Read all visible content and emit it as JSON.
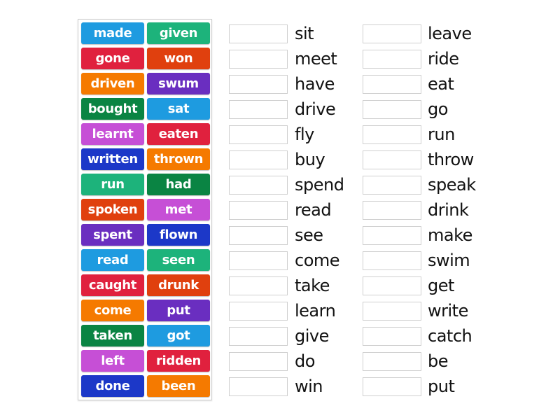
{
  "tiles": [
    {
      "label": "made",
      "color": "#1E9BE0"
    },
    {
      "label": "given",
      "color": "#1DB37B"
    },
    {
      "label": "gone",
      "color": "#E0213E"
    },
    {
      "label": "won",
      "color": "#E0400E"
    },
    {
      "label": "driven",
      "color": "#F57A00"
    },
    {
      "label": "swum",
      "color": "#6A2EC0"
    },
    {
      "label": "bought",
      "color": "#0A8443"
    },
    {
      "label": "sat",
      "color": "#1E9BE0"
    },
    {
      "label": "learnt",
      "color": "#C64FD6"
    },
    {
      "label": "eaten",
      "color": "#E0213E"
    },
    {
      "label": "written",
      "color": "#1C38C8"
    },
    {
      "label": "thrown",
      "color": "#F57A00"
    },
    {
      "label": "run",
      "color": "#1DB37B"
    },
    {
      "label": "had",
      "color": "#0A8443"
    },
    {
      "label": "spoken",
      "color": "#E0400E"
    },
    {
      "label": "met",
      "color": "#C64FD6"
    },
    {
      "label": "spent",
      "color": "#6A2EC0"
    },
    {
      "label": "flown",
      "color": "#1C38C8"
    },
    {
      "label": "read",
      "color": "#1E9BE0"
    },
    {
      "label": "seen",
      "color": "#1DB37B"
    },
    {
      "label": "caught",
      "color": "#E0213E"
    },
    {
      "label": "drunk",
      "color": "#E0400E"
    },
    {
      "label": "come",
      "color": "#F57A00"
    },
    {
      "label": "put",
      "color": "#6A2EC0"
    },
    {
      "label": "taken",
      "color": "#0A8443"
    },
    {
      "label": "got",
      "color": "#1E9BE0"
    },
    {
      "label": "left",
      "color": "#C64FD6"
    },
    {
      "label": "ridden",
      "color": "#E0213E"
    },
    {
      "label": "done",
      "color": "#1C38C8"
    },
    {
      "label": "been",
      "color": "#F57A00"
    }
  ],
  "prompts_left": [
    "sit",
    "meet",
    "have",
    "drive",
    "fly",
    "buy",
    "spend",
    "read",
    "see",
    "come",
    "take",
    "learn",
    "give",
    "do",
    "win"
  ],
  "prompts_right": [
    "leave",
    "ride",
    "eat",
    "go",
    "run",
    "throw",
    "speak",
    "drink",
    "make",
    "swim",
    "get",
    "write",
    "catch",
    "be",
    "put"
  ]
}
